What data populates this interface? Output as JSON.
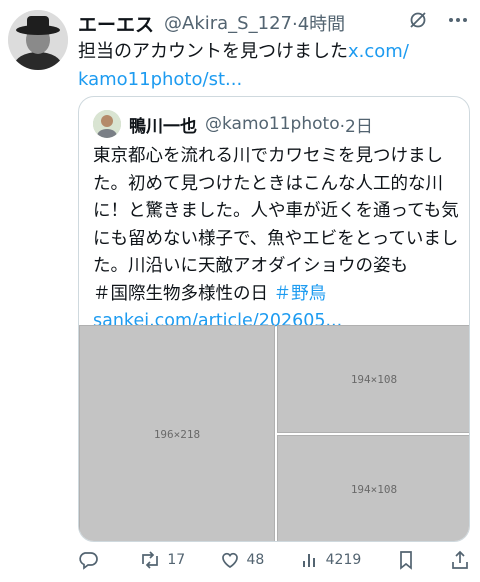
{
  "post": {
    "author_name": "エーエス",
    "author_handle": "@Akira_S_127",
    "time": "·4時間",
    "text": "担当のアカウントを見つけました",
    "link_line1": "x.com/",
    "link_line2": "kamo11photo/st..."
  },
  "quoted": {
    "author_name": "鴨川一也",
    "author_handle": "@kamo11photo",
    "time": "·2日",
    "text": "東京都心を流れる川でカワセミを見つけました。初めて見つけたときはこんな人工的な川に！と驚きました。人や車が近くを通っても気にも留めない様子で、魚やエビをとっていました。川沿いに天敵アオダイショウの姿も",
    "hashtag1": "＃国際生物多様性の日",
    "hashtag2": "＃野鳥",
    "link": "sankei.com/article/202605..."
  },
  "actions": {
    "reply_count": "",
    "repost_count": "17",
    "like_count": "48",
    "views_count": "4219"
  },
  "icons": {
    "grok": "grok-icon",
    "more": "more-icon",
    "reply": "reply-icon",
    "repost": "repost-icon",
    "like": "heart-icon",
    "views": "views-icon",
    "bookmark": "bookmark-icon",
    "share": "share-icon"
  },
  "colors": {
    "link": "#1d9bf0",
    "muted": "#536471",
    "text": "#0f1419",
    "border": "#cfd9de"
  }
}
